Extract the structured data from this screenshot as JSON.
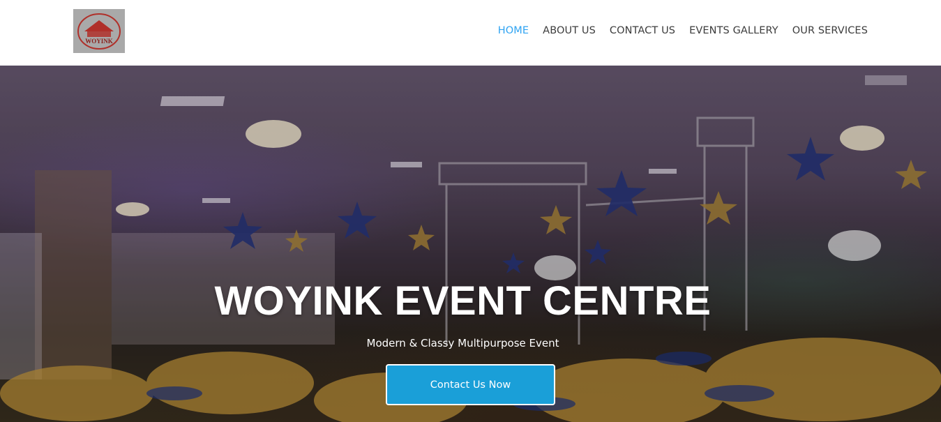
{
  "header": {
    "logo_text": "WOYINK",
    "nav": [
      {
        "label": "HOME",
        "active": true
      },
      {
        "label": "ABOUT US",
        "active": false
      },
      {
        "label": "CONTACT US",
        "active": false
      },
      {
        "label": "EVENTS GALLERY",
        "active": false
      },
      {
        "label": "OUR SERVICES",
        "active": false
      }
    ]
  },
  "hero": {
    "title": "WOYINK EVENT CENTRE",
    "subtitle": "Modern & Classy Multipurpose Event",
    "cta_label": "Contact Us Now"
  },
  "colors": {
    "nav_active": "#2ea3f2",
    "nav_text": "#3c3c3c",
    "cta_background": "#1a9fd8"
  }
}
